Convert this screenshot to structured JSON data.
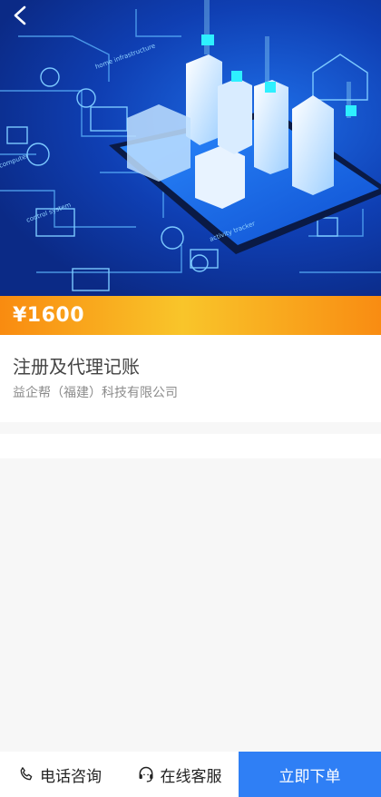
{
  "header": {
    "back_icon": "chevron-left-icon"
  },
  "hero": {
    "image": "smart-city-phone-illustration",
    "labels": [
      "home infrastructure",
      "control system",
      "computer",
      "activity tracker"
    ]
  },
  "product": {
    "price": "¥1600",
    "title": "注册及代理记账",
    "company": "益企帮（福建）科技有限公司"
  },
  "bottom_bar": {
    "phone_label": "电话咨询",
    "phone_icon": "phone-icon",
    "service_label": "在线客服",
    "service_icon": "headset-icon",
    "order_label": "立即下单"
  },
  "colors": {
    "price_gradient": [
      "#f98b10",
      "#f9c52a",
      "#f98c12"
    ],
    "order_button": "#2f7ff5"
  }
}
